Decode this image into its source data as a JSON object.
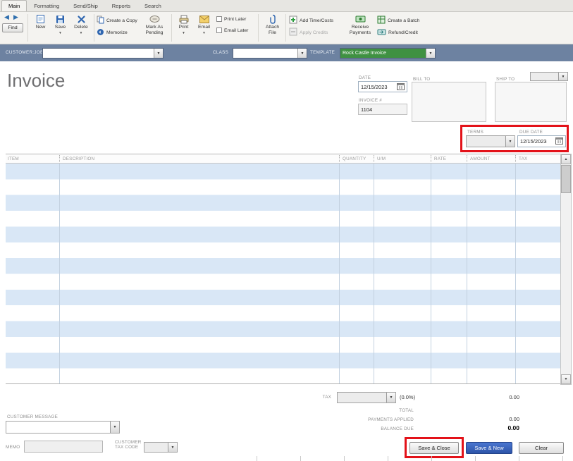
{
  "icons": {
    "back_arrow": "◀",
    "forward_arrow": "▶",
    "dropdown_arrow": "▼",
    "scroll_up": "▲",
    "scroll_down": "▼"
  },
  "tabs": [
    {
      "label": "Main"
    },
    {
      "label": "Formatting"
    },
    {
      "label": "Send/Ship"
    },
    {
      "label": "Reports"
    },
    {
      "label": "Search"
    }
  ],
  "toolbar": {
    "find": "Find",
    "new": "New",
    "save": "Save",
    "delete": "Delete",
    "create_copy": "Create a Copy",
    "memorize": "Memorize",
    "mark_pending": "Mark As Pending",
    "print": "Print",
    "email": "Email",
    "print_later": "Print Later",
    "email_later": "Email Later",
    "attach_file": "Attach File",
    "add_time_costs": "Add Time/Costs",
    "apply_credits": "Apply Credits",
    "receive_payments": "Receive Payments",
    "create_batch": "Create a Batch",
    "refund_credit": "Refund/Credit"
  },
  "selector_bar": {
    "customer_job_label": "CUSTOMER:JOB",
    "customer_job_value": "",
    "class_label": "CLASS",
    "class_value": "",
    "template_label": "TEMPLATE",
    "template_value": "Rock Castle Invoice"
  },
  "invoice": {
    "title": "Invoice",
    "date_label": "DATE",
    "date_value": "12/15/2023",
    "invoice_no_label": "INVOICE #",
    "invoice_no_value": "1104",
    "bill_to_label": "BILL TO",
    "ship_to_label": "SHIP TO",
    "ship_to_value": "",
    "terms_label": "TERMS",
    "terms_value": "",
    "due_date_label": "DUE DATE",
    "due_date_value": "12/15/2023"
  },
  "line_items": {
    "columns": [
      "ITEM",
      "DESCRIPTION",
      "QUANTITY",
      "U/M",
      "RATE",
      "AMOUNT",
      "TAX"
    ],
    "rows": []
  },
  "totals": {
    "tax_label": "TAX",
    "tax_value": "",
    "tax_rate": "(0.0%)",
    "tax_amount": "0.00",
    "total_label": "TOTAL",
    "payments_applied_label": "PAYMENTS APPLIED",
    "payments_applied_value": "0.00",
    "balance_due_label": "BALANCE DUE",
    "balance_due_value": "0.00"
  },
  "footer": {
    "customer_message_label": "CUSTOMER MESSAGE",
    "customer_message_value": "",
    "memo_label": "MEMO",
    "memo_value": "",
    "customer_tax_code_label": "CUSTOMER TAX CODE",
    "customer_tax_code_value": "",
    "save_close_button": "Save & Close",
    "save_new_button": "Save & New",
    "clear_button": "Clear"
  },
  "colors": {
    "selector_bar_bg": "#6d82a1",
    "template_selected_bg": "#3f9142",
    "row_stripe": "#d9e7f6",
    "primary_button": "#3a67c8",
    "annotation": "#e31219"
  }
}
